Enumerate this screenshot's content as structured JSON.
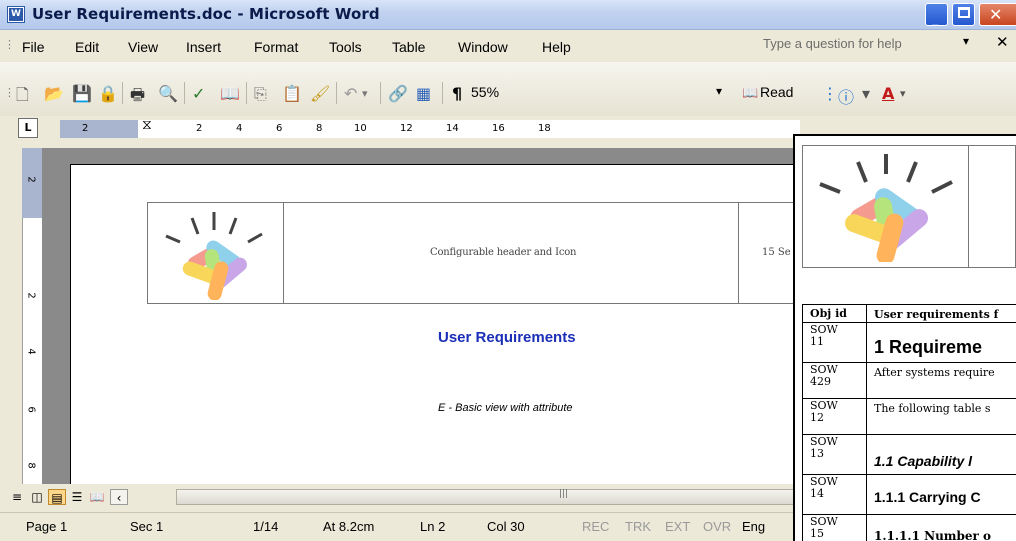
{
  "window": {
    "title": "User Requirements.doc - Microsoft Word",
    "app_icon_letter": "W"
  },
  "menu": {
    "items": [
      "File",
      "Edit",
      "View",
      "Insert",
      "Format",
      "Tools",
      "Table",
      "Window",
      "Help"
    ],
    "help_placeholder": "Type a question for help"
  },
  "toolbar": {
    "zoom": "55%",
    "read_label": "Read",
    "paragraph_mark": "¶"
  },
  "ruler": {
    "labels": [
      "2",
      "2",
      "4",
      "6",
      "8",
      "10",
      "12",
      "14",
      "16",
      "18"
    ]
  },
  "vruler": {
    "labels": [
      "2",
      "2",
      "4",
      "6",
      "8"
    ]
  },
  "document": {
    "header_cell": "Configurable header and Icon",
    "header_date": "15 Se",
    "title": "User Requirements",
    "subtitle": "E - Basic view with attribute"
  },
  "status": {
    "page": "Page 1",
    "sec": "Sec 1",
    "pages": "1/14",
    "at": "At 8.2cm",
    "ln": "Ln 2",
    "col": "Col 30",
    "rec": "REC",
    "trk": "TRK",
    "ext": "EXT",
    "ovr": "OVR",
    "lang": "Eng"
  },
  "overlay": {
    "col_id": "Obj id",
    "col_text": "User requirements f",
    "rows": [
      {
        "id": "SOW\n11",
        "text": "1   Requireme"
      },
      {
        "id": "SOW\n429",
        "text": "After systems require"
      },
      {
        "id": "SOW\n12",
        "text": "The following table s"
      },
      {
        "id": "SOW\n13",
        "text": "1.1   Capability l"
      },
      {
        "id": "SOW\n14",
        "text": "1.1.1   Carrying C"
      },
      {
        "id": "SOW\n15",
        "text": "1.1.1.1 Number o"
      }
    ]
  },
  "colors": {
    "title_blue": "#1b2fb8",
    "ruler_grey": "#a9b5cf"
  }
}
